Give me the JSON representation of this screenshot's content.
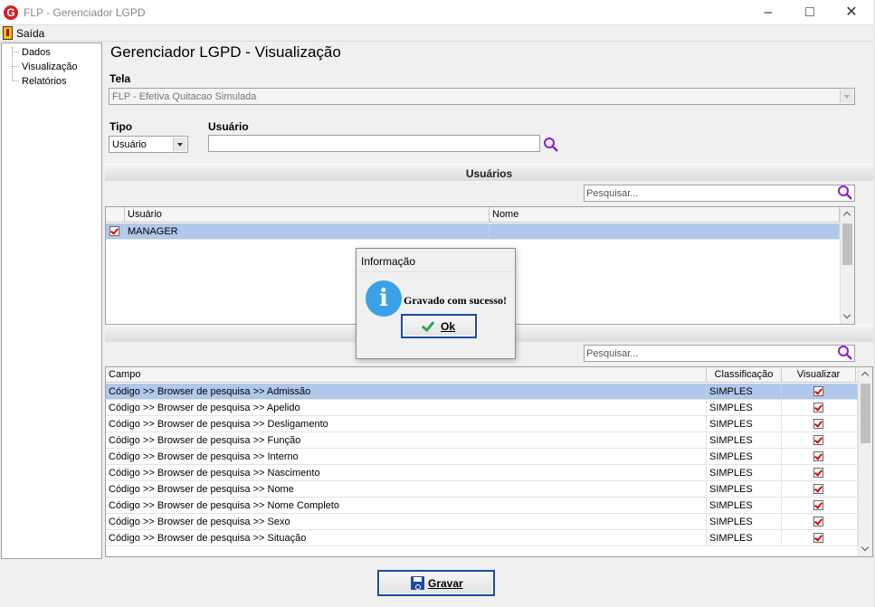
{
  "window": {
    "title": "FLP - Gerenciador LGPD",
    "minimize_glyph": "–",
    "maximize_glyph": "□",
    "close_glyph": "✕"
  },
  "menu": {
    "saida": "Saída"
  },
  "sidebar": {
    "items": [
      {
        "label": "Dados"
      },
      {
        "label": "Visualização"
      },
      {
        "label": "Relatórios"
      }
    ]
  },
  "page": {
    "title": "Gerenciador LGPD - Visualização"
  },
  "form": {
    "tela_label": "Tela",
    "tela_value": "FLP - Efetiva Quitacao Simulada",
    "tipo_label": "Tipo",
    "tipo_value": "Usuário",
    "usuario_label": "Usuário",
    "usuario_value": ""
  },
  "usuarios_section": {
    "header": "Usuários",
    "search_placeholder": "Pesquisar...",
    "columns": [
      "Usuário",
      "Nome"
    ],
    "rows": [
      {
        "checked": true,
        "usuario": "MANAGER",
        "nome": ""
      }
    ]
  },
  "campos_section": {
    "header": "Campo",
    "search_placeholder": "Pesquisar...",
    "columns": [
      "Campo",
      "Classificação",
      "Visualizar"
    ],
    "rows": [
      {
        "campo": "Código >> Browser de pesquisa >> Admissão",
        "classificacao": "SIMPLES",
        "visualizar": true
      },
      {
        "campo": "Código >> Browser de pesquisa >> Apelido",
        "classificacao": "SIMPLES",
        "visualizar": true
      },
      {
        "campo": "Código >> Browser de pesquisa >> Desligamento",
        "classificacao": "SIMPLES",
        "visualizar": true
      },
      {
        "campo": "Código >> Browser de pesquisa >> Função",
        "classificacao": "SIMPLES",
        "visualizar": true
      },
      {
        "campo": "Código >> Browser de pesquisa >> Interno",
        "classificacao": "SIMPLES",
        "visualizar": true
      },
      {
        "campo": "Código >> Browser de pesquisa >> Nascimento",
        "classificacao": "SIMPLES",
        "visualizar": true
      },
      {
        "campo": "Código >> Browser de pesquisa >> Nome",
        "classificacao": "SIMPLES",
        "visualizar": true
      },
      {
        "campo": "Código >> Browser de pesquisa >> Nome Completo",
        "classificacao": "SIMPLES",
        "visualizar": true
      },
      {
        "campo": "Código >> Browser de pesquisa >> Sexo",
        "classificacao": "SIMPLES",
        "visualizar": true
      },
      {
        "campo": "Código >> Browser de pesquisa >> Situação",
        "classificacao": "SIMPLES",
        "visualizar": true
      }
    ]
  },
  "footer": {
    "gravar_label": "Gravar"
  },
  "dialog": {
    "title": "Informação",
    "icon": "info-icon",
    "message": "Gravado com sucesso!",
    "ok_label": "Ok"
  },
  "colors": {
    "selected_row": "#b0c8ea",
    "button_border": "#1c4aa0",
    "info_icon": "#3aa0e8",
    "search_icon": "#8a1fcf",
    "check_red": "#dd0000",
    "ok_check": "#2fa84a"
  }
}
